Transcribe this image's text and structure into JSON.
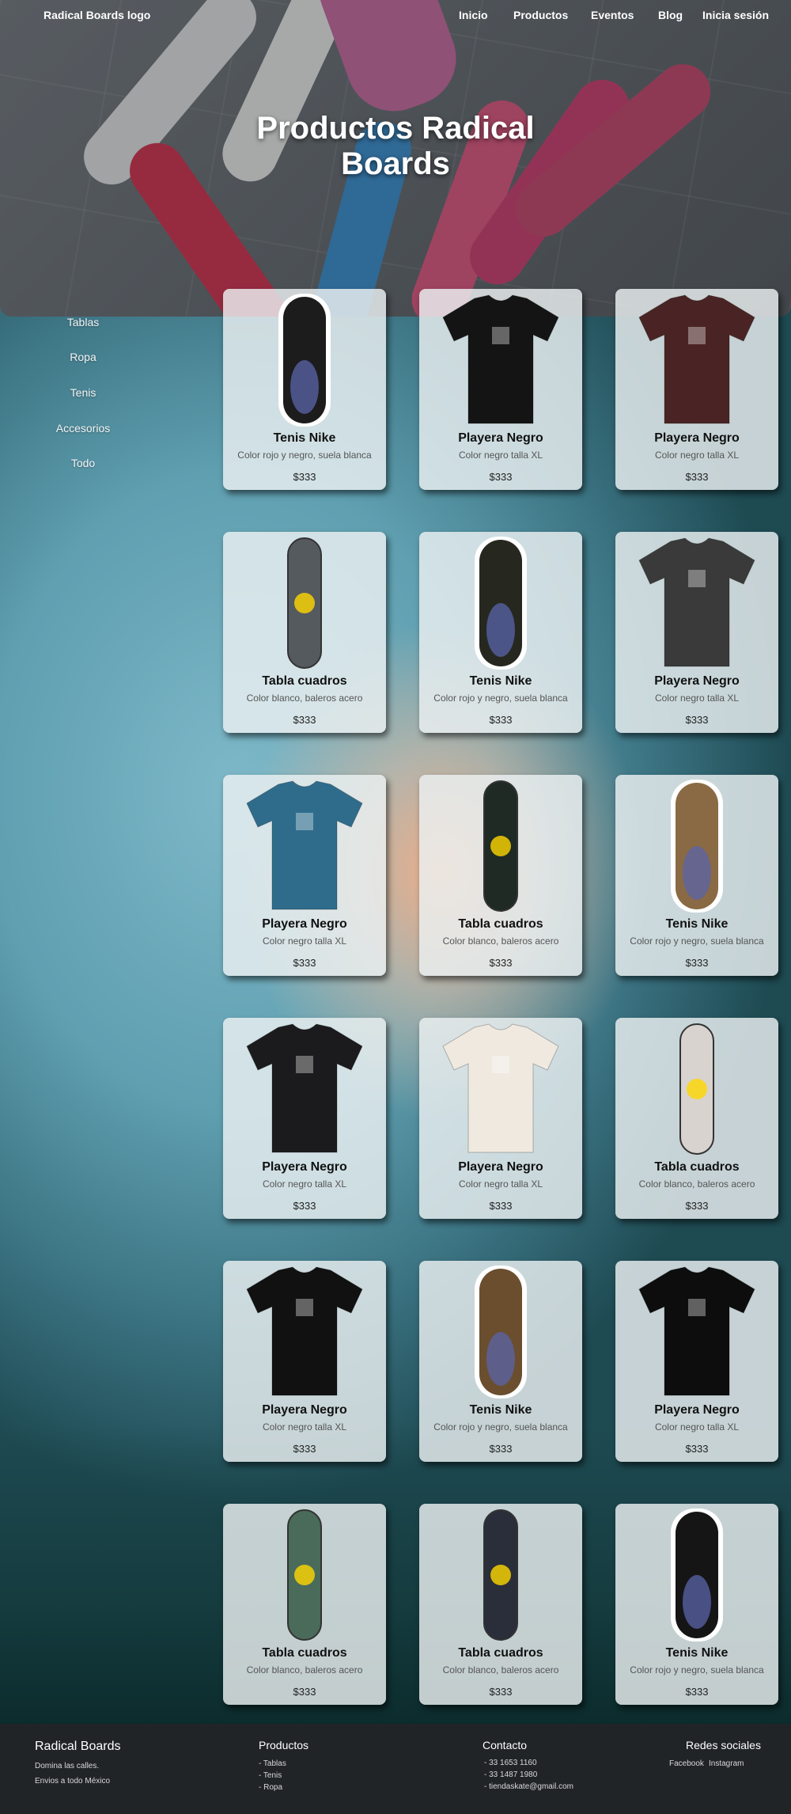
{
  "nav": {
    "logo": "Radical Boards logo",
    "links": [
      "Inicio",
      "Productos",
      "Eventos",
      "Blog",
      "Inicia sesión"
    ]
  },
  "hero": {
    "title": "Productos Radical Boards"
  },
  "sidebar": {
    "items": [
      "Tablas",
      "Ropa",
      "Tenis",
      "Accesorios",
      "Todo"
    ]
  },
  "products": [
    {
      "title": "Tenis Nike",
      "desc": "Color rojo y negro, suela blanca",
      "price": "$333",
      "kind": "shoe",
      "color": "#1c1c1c"
    },
    {
      "title": "Playera Negro",
      "desc": "Color negro talla XL",
      "price": "$333",
      "kind": "shirt",
      "color": "#141414"
    },
    {
      "title": "Playera Negro",
      "desc": "Color negro talla XL",
      "price": "$333",
      "kind": "shirt",
      "color": "#4a2424"
    },
    {
      "title": "Tabla cuadros",
      "desc": "Color blanco, baleros acero",
      "price": "$333",
      "kind": "deck",
      "color": "#555a5e"
    },
    {
      "title": "Tenis Nike",
      "desc": "Color rojo y negro, suela blanca",
      "price": "$333",
      "kind": "shoe",
      "color": "#262820"
    },
    {
      "title": "Playera Negro",
      "desc": "Color negro talla XL",
      "price": "$333",
      "kind": "shirt",
      "color": "#3a3a3a"
    },
    {
      "title": "Playera Negro",
      "desc": "Color negro talla XL",
      "price": "$333",
      "kind": "shirt",
      "color": "#2f6c8c"
    },
    {
      "title": "Tabla cuadros",
      "desc": "Color blanco, baleros acero",
      "price": "$333",
      "kind": "deck",
      "color": "#1f2a24"
    },
    {
      "title": "Tenis Nike",
      "desc": "Color rojo y negro, suela blanca",
      "price": "$333",
      "kind": "shoe",
      "color": "#8a6a44"
    },
    {
      "title": "Playera Negro",
      "desc": "Color negro talla XL",
      "price": "$333",
      "kind": "shirt",
      "color": "#1b1b1d"
    },
    {
      "title": "Playera Negro",
      "desc": "Color negro talla XL",
      "price": "$333",
      "kind": "shirt",
      "color": "#efe9e0"
    },
    {
      "title": "Tabla cuadros",
      "desc": "Color blanco, baleros acero",
      "price": "$333",
      "kind": "deck",
      "color": "#d8d3cf"
    },
    {
      "title": "Playera Negro",
      "desc": "Color negro talla XL",
      "price": "$333",
      "kind": "shirt",
      "color": "#111"
    },
    {
      "title": "Tenis Nike",
      "desc": "Color rojo y negro, suela blanca",
      "price": "$333",
      "kind": "shoe",
      "color": "#6a4e2e"
    },
    {
      "title": "Playera Negro",
      "desc": "Color negro talla XL",
      "price": "$333",
      "kind": "shirt",
      "color": "#0d0d0d"
    },
    {
      "title": "Tabla cuadros",
      "desc": "Color blanco, baleros acero",
      "price": "$333",
      "kind": "deck",
      "color": "#4a6b5a"
    },
    {
      "title": "Tabla cuadros",
      "desc": "Color blanco, baleros acero",
      "price": "$333",
      "kind": "deck",
      "color": "#2a2d3a"
    },
    {
      "title": "Tenis Nike",
      "desc": "Color rojo y negro, suela blanca",
      "price": "$333",
      "kind": "shoe",
      "color": "#151515"
    }
  ],
  "footer": {
    "brand": "Radical Boards",
    "brand_lines": [
      "Domina las calles.",
      "Envios a todo México"
    ],
    "products_title": "Productos",
    "products_links": [
      "- Tablas",
      "- Tenis",
      "- Ropa"
    ],
    "contact_title": "Contacto",
    "contact_lines": [
      "- 33 1653 1160",
      "- 33 1487 1980",
      "- tiendaskate@gmail.com"
    ],
    "social_title": "Redes sociales",
    "social_links": [
      "Facebook",
      "Instagram"
    ]
  }
}
